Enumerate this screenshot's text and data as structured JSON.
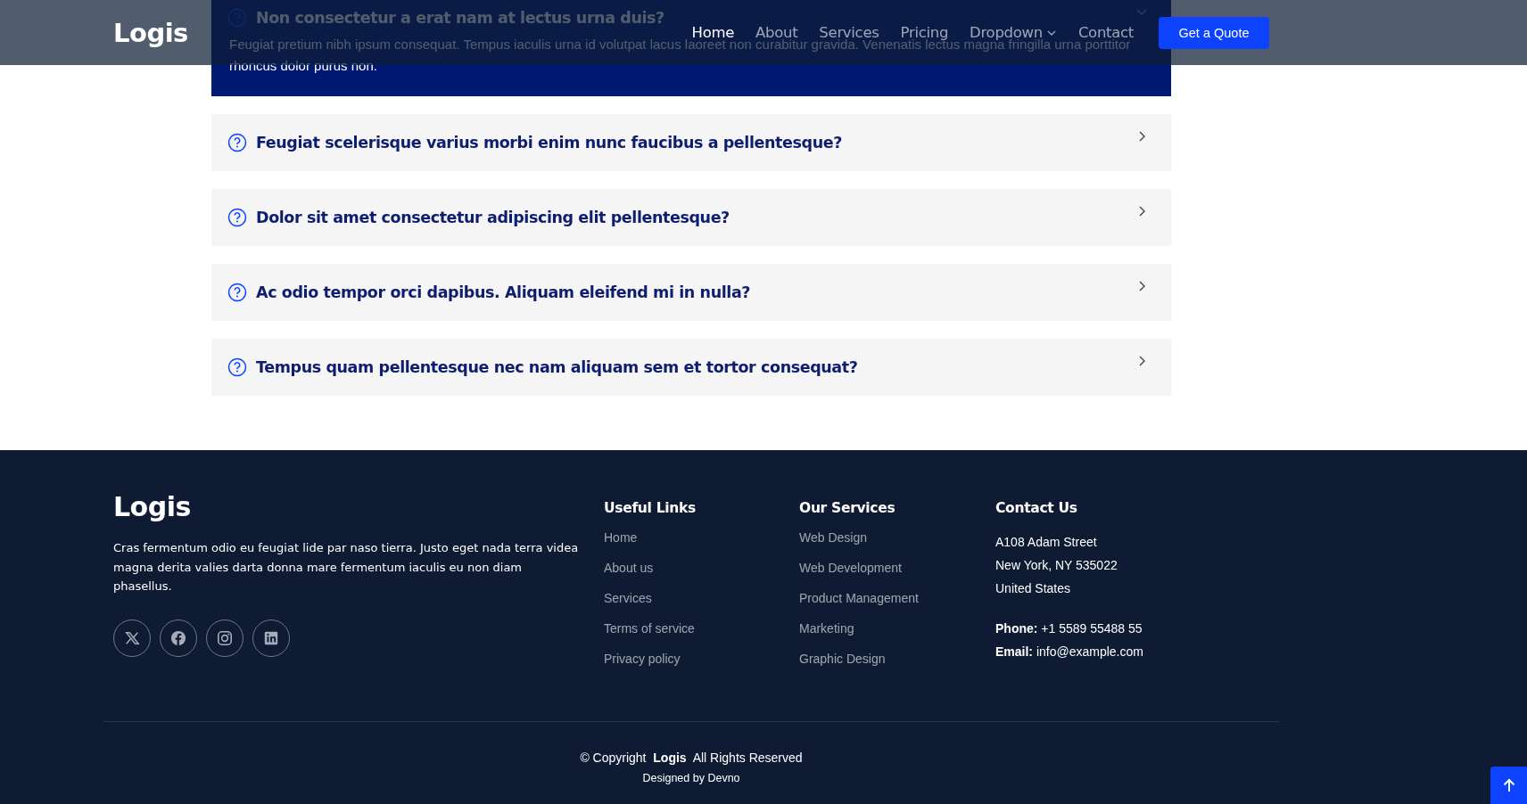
{
  "header": {
    "logo": "Logis",
    "nav": [
      {
        "label": "Home",
        "selected": true,
        "kind": "link"
      },
      {
        "label": "About",
        "selected": false,
        "kind": "link"
      },
      {
        "label": "Services",
        "selected": false,
        "kind": "link"
      },
      {
        "label": "Pricing",
        "selected": false,
        "kind": "link"
      },
      {
        "label": "Dropdown",
        "selected": false,
        "kind": "dropdown"
      },
      {
        "label": "Contact",
        "selected": false,
        "kind": "link"
      }
    ],
    "cta": "Get a Quote"
  },
  "faq": [
    {
      "question": "Non consectetur a erat nam at lectus urna duis?",
      "expanded": true,
      "answer": "Feugiat pretium nibh ipsum consequat. Tempus iaculis urna id volutpat lacus laoreet non curabitur gravida. Venenatis lectus magna fringilla urna porttitor rhoncus dolor purus non."
    },
    {
      "question": "Feugiat scelerisque varius morbi enim nunc faucibus a pellentesque?",
      "expanded": false
    },
    {
      "question": "Dolor sit amet consectetur adipiscing elit pellentesque?",
      "expanded": false
    },
    {
      "question": "Ac odio tempor orci dapibus. Aliquam eleifend mi in nulla?",
      "expanded": false
    },
    {
      "question": "Tempus quam pellentesque nec nam aliquam sem et tortor consequat?",
      "expanded": false
    }
  ],
  "footer": {
    "logo": "Logis",
    "description": "Cras fermentum odio eu feugiat lide par naso tierra. Justo eget nada terra videa magna derita valies darta donna mare fermentum iaculis eu non diam phasellus.",
    "social": [
      {
        "kind": "x"
      },
      {
        "kind": "facebook"
      },
      {
        "kind": "instagram"
      },
      {
        "kind": "linkedin"
      }
    ],
    "useful_links": {
      "title": "Useful Links",
      "links": [
        "Home",
        "About us",
        "Services",
        "Terms of service",
        "Privacy policy"
      ]
    },
    "services": {
      "title": "Our Services",
      "links": [
        "Web Design",
        "Web Development",
        "Product Management",
        "Marketing",
        "Graphic Design"
      ]
    },
    "contact": {
      "title": "Contact Us",
      "address": [
        "A108 Adam Street",
        "New York, NY 535022",
        "United States"
      ],
      "phone": "**Phone:** +1 5589 55488 55",
      "email": "**Email:** info@example.com"
    },
    "copyright": "© Copyright  **Logis**  All Rights Reserved",
    "credits": "Designed by Devno"
  }
}
